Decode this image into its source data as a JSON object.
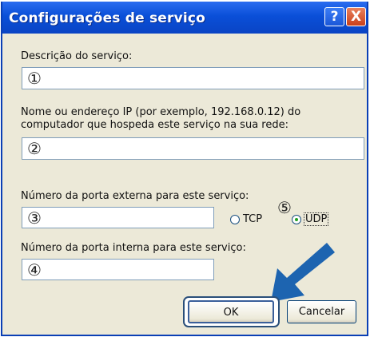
{
  "window": {
    "title": "Configurações de serviço",
    "help_button": "?",
    "close_button": "X"
  },
  "fields": {
    "description_label": "Descrição do serviço:",
    "description_marker": "①",
    "host_label_line1": "Nome ou endereço IP (por exemplo, 192.168.0.12) do",
    "host_label_line2": "computador que hospeda este serviço na sua rede:",
    "host_marker": "②",
    "external_port_label": "Número da porta externa para este serviço:",
    "external_port_marker": "③",
    "internal_port_label": "Número da porta interna para este serviço:",
    "internal_port_marker": "④"
  },
  "protocol": {
    "marker": "⑤",
    "tcp_label": "TCP",
    "udp_label": "UDP",
    "selected": "UDP"
  },
  "buttons": {
    "ok_label": "OK",
    "cancel_label": "Cancelar"
  },
  "colors": {
    "titlebar": "#0a4fd8",
    "arrow": "#1d64b0",
    "dialog_bg": "#ece9d8"
  }
}
